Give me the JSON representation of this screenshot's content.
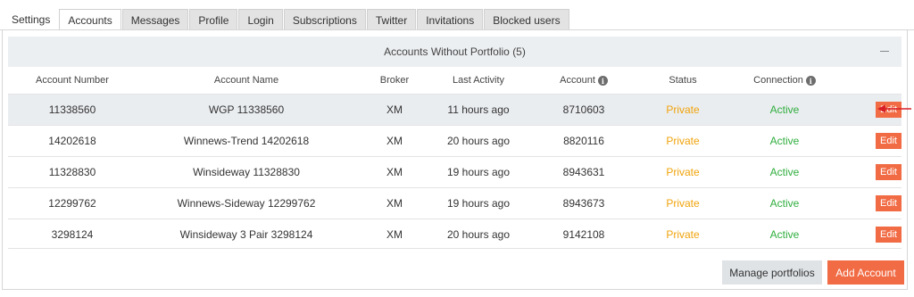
{
  "tabs": [
    {
      "label": "Settings"
    },
    {
      "label": "Accounts"
    },
    {
      "label": "Messages"
    },
    {
      "label": "Profile"
    },
    {
      "label": "Login"
    },
    {
      "label": "Subscriptions"
    },
    {
      "label": "Twitter"
    },
    {
      "label": "Invitations"
    },
    {
      "label": "Blocked users"
    }
  ],
  "active_tab": "Accounts",
  "panel": {
    "title": "Accounts Without Portfolio (5)",
    "collapse_icon": "minus-icon"
  },
  "table": {
    "headers": {
      "account_number": "Account Number",
      "account_name": "Account Name",
      "broker": "Broker",
      "last_activity": "Last Activity",
      "account": "Account",
      "status": "Status",
      "connection": "Connection"
    },
    "info_icon": "i",
    "rows": [
      {
        "account_number": "11338560",
        "account_name": "WGP 11338560",
        "broker": "XM",
        "last_activity": "11 hours ago",
        "account": "8710603",
        "status": "Private",
        "connection": "Active",
        "action": "Edit"
      },
      {
        "account_number": "14202618",
        "account_name": "Winnews-Trend 14202618",
        "broker": "XM",
        "last_activity": "20 hours ago",
        "account": "8820116",
        "status": "Private",
        "connection": "Active",
        "action": "Edit"
      },
      {
        "account_number": "11328830",
        "account_name": "Winsideway 11328830",
        "broker": "XM",
        "last_activity": "19 hours ago",
        "account": "8943631",
        "status": "Private",
        "connection": "Active",
        "action": "Edit"
      },
      {
        "account_number": "12299762",
        "account_name": "Winnews-Sideway 12299762",
        "broker": "XM",
        "last_activity": "19 hours ago",
        "account": "8943673",
        "status": "Private",
        "connection": "Active",
        "action": "Edit"
      },
      {
        "account_number": "3298124",
        "account_name": "Winsideway 3 Pair 3298124",
        "broker": "XM",
        "last_activity": "20 hours ago",
        "account": "9142108",
        "status": "Private",
        "connection": "Active",
        "action": "Edit"
      }
    ]
  },
  "footer": {
    "manage_label": "Manage portfolios",
    "add_label": "Add Account"
  },
  "colors": {
    "accent": "#f16b44",
    "status_private": "#f0a30a",
    "connection_active": "#2fae3d",
    "annotation_arrow": "#d81f26"
  }
}
